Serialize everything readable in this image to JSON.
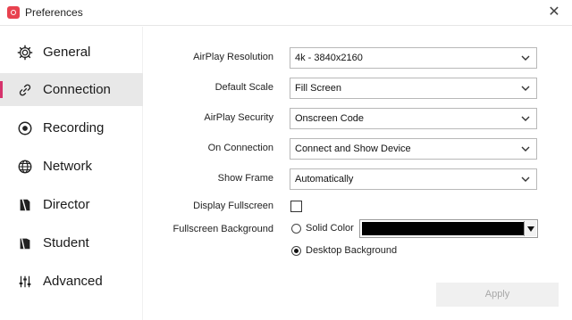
{
  "window": {
    "title": "Preferences",
    "close_glyph": "✕",
    "accent_color": "#d6336c"
  },
  "sidebar": {
    "items": [
      {
        "label": "General",
        "icon": "gear-icon",
        "active": false
      },
      {
        "label": "Connection",
        "icon": "link-icon",
        "active": true
      },
      {
        "label": "Recording",
        "icon": "record-icon",
        "active": false
      },
      {
        "label": "Network",
        "icon": "globe-icon",
        "active": false
      },
      {
        "label": "Director",
        "icon": "director-icon",
        "active": false
      },
      {
        "label": "Student",
        "icon": "student-icon",
        "active": false
      },
      {
        "label": "Advanced",
        "icon": "sliders-icon",
        "active": false
      }
    ]
  },
  "connection": {
    "airplay_resolution": {
      "label": "AirPlay Resolution",
      "value": "4k - 3840x2160"
    },
    "default_scale": {
      "label": "Default Scale",
      "value": "Fill Screen"
    },
    "airplay_security": {
      "label": "AirPlay Security",
      "value": "Onscreen Code"
    },
    "on_connection": {
      "label": "On Connection",
      "value": "Connect and Show Device"
    },
    "show_frame": {
      "label": "Show Frame",
      "value": "Automatically"
    },
    "display_fullscreen": {
      "label": "Display Fullscreen",
      "checked": false
    },
    "fullscreen_background": {
      "label": "Fullscreen Background",
      "solid_color_label": "Solid Color",
      "desktop_background_label": "Desktop Background",
      "selected": "Desktop Background",
      "color": "#000000"
    }
  },
  "footer": {
    "apply_label": "Apply",
    "apply_enabled": false
  }
}
